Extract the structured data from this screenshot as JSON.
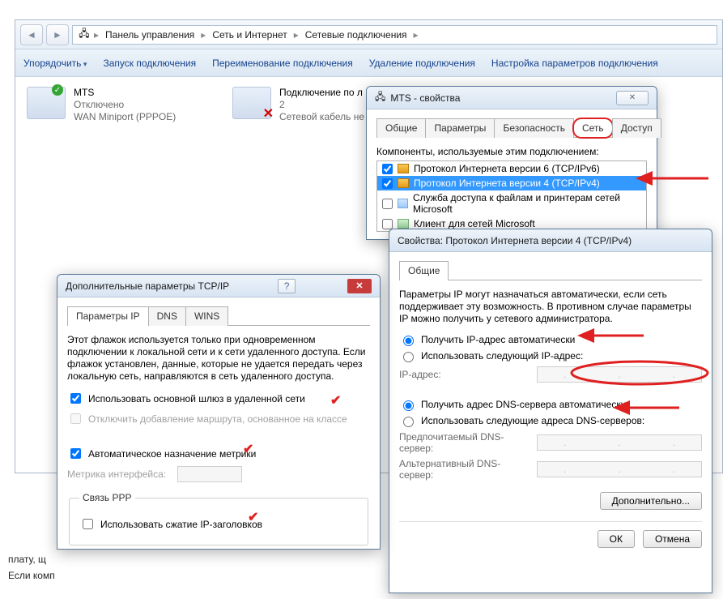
{
  "breadcrumb": {
    "items": [
      "Панель управления",
      "Сеть и Интернет",
      "Сетевые подключения"
    ]
  },
  "toolbar": {
    "organize": "Упорядочить",
    "start": "Запуск подключения",
    "rename": "Переименование подключения",
    "delete": "Удаление подключения",
    "settings": "Настройка параметров подключения"
  },
  "connections": {
    "mts": {
      "title": "MTS",
      "status": "Отключено",
      "driver": "WAN Miniport (PPPOE)"
    },
    "lan": {
      "title": "Подключение по л",
      "status": "2",
      "driver": "Сетевой кабель не"
    }
  },
  "mts_dialog": {
    "title": "MTS - свойства",
    "tabs": [
      "Общие",
      "Параметры",
      "Безопасность",
      "Сеть",
      "Доступ"
    ],
    "components_label": "Компоненты, используемые этим подключением:",
    "components": [
      "Протокол Интернета версии 6 (TCP/IPv6)",
      "Протокол Интернета версии 4 (TCP/IPv4)",
      "Служба доступа к файлам и принтерам сетей Microsoft",
      "Клиент для сетей Microsoft"
    ]
  },
  "ipv4_dialog": {
    "title": "Свойства: Протокол Интернета версии 4 (TCP/IPv4)",
    "tab": "Общие",
    "desc": "Параметры IP могут назначаться автоматически, если сеть поддерживает эту возможность. В противном случае параметры IP можно получить у сетевого администратора.",
    "radio_ip_auto": "Получить IP-адрес автоматически",
    "radio_ip_manual": "Использовать следующий IP-адрес:",
    "ip_label": "IP-адрес:",
    "radio_dns_auto": "Получить адрес DNS-сервера автоматически",
    "radio_dns_manual": "Использовать следующие адреса DNS-серверов:",
    "dns_pref": "Предпочитаемый DNS-сервер:",
    "dns_alt": "Альтернативный DNS-сервер:",
    "advanced": "Дополнительно...",
    "ok": "ОК",
    "cancel": "Отмена"
  },
  "adv_dialog": {
    "title": "Дополнительные параметры TCP/IP",
    "tabs": [
      "Параметры IP",
      "DNS",
      "WINS"
    ],
    "desc": "Этот флажок используется только при одновременном подключении к локальной сети и к сети удаленного доступа. Если флажок установлен, данные, которые не удается передать через локальную сеть, направляются в сеть удаленного доступа.",
    "chk_gateway": "Использовать основной шлюз в удаленной сети",
    "chk_route": "Отключить добавление маршрута, основанное на классе",
    "chk_metric": "Автоматическое назначение метрики",
    "metric_label": "Метрика интерфейса:",
    "ppp_legend": "Связь PPP",
    "chk_ppp": "Использовать сжатие IP-заголовков"
  },
  "bg": {
    "l1": "плату, щ",
    "l2": "Если комп"
  }
}
